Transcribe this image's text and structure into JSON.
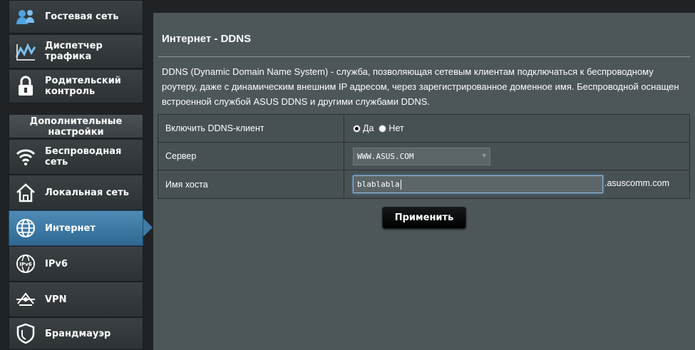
{
  "sidebar": {
    "top_items": [
      {
        "label": "Гостевая сеть",
        "icon": "guest-network-icon"
      },
      {
        "label": "Диспетчер трафика",
        "icon": "traffic-manager-icon"
      },
      {
        "label": "Родительский контроль",
        "icon": "parental-control-icon"
      }
    ],
    "section_title": "Дополнительные настройки",
    "advanced_items": [
      {
        "label": "Беспроводная сеть",
        "icon": "wireless-icon"
      },
      {
        "label": "Локальная сеть",
        "icon": "lan-icon"
      },
      {
        "label": "Интернет",
        "icon": "internet-globe-icon",
        "active": true
      },
      {
        "label": "IPv6",
        "icon": "ipv6-icon"
      },
      {
        "label": "VPN",
        "icon": "vpn-icon"
      },
      {
        "label": "Брандмауэр",
        "icon": "firewall-icon"
      }
    ]
  },
  "main": {
    "title": "Интернет - DDNS",
    "description": "DDNS (Dynamic Domain Name System) - служба, позволяющая сетевым клиентам подключаться к беспроводному роутеру, даже с динамическим внешним IP адресом, через зарегистрированное доменное имя. Беспроводной оснащен встроенной службой ASUS DDNS и другими службами DDNS.",
    "form": {
      "enable": {
        "label": "Включить DDNS-клиент",
        "option_yes": "Да",
        "option_no": "Нет",
        "selected": "Да"
      },
      "server": {
        "label": "Сервер",
        "value": "WWW.ASUS.COM"
      },
      "hostname": {
        "label": "Имя хоста",
        "value": "blablabla",
        "suffix": ".asuscomm.com"
      }
    },
    "apply_label": "Применить"
  }
}
